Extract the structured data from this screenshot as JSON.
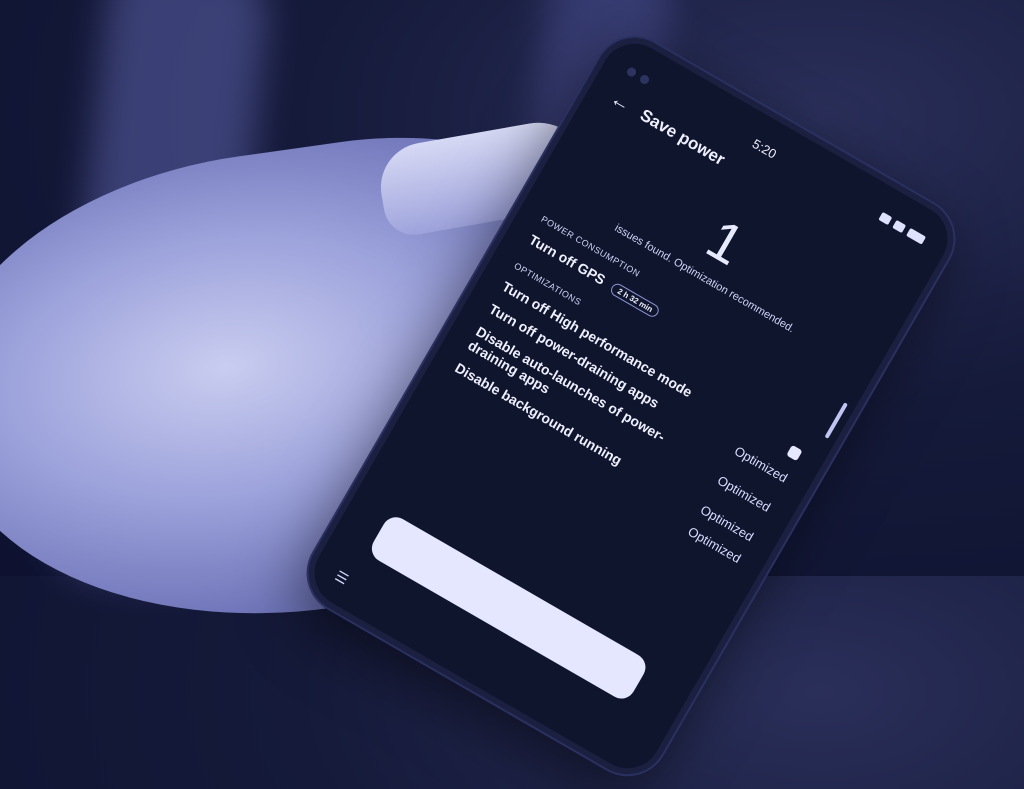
{
  "status": {
    "time": "5:20"
  },
  "header": {
    "back_icon": "arrow-left-icon",
    "title": "Save power"
  },
  "summary": {
    "count": "1",
    "message": "issues found. Optimization recommended."
  },
  "power_consumption": {
    "section_label": "POWER CONSUMPTION",
    "item_label": "Turn off GPS",
    "item_chip": "2 h 32 min"
  },
  "optimizations": {
    "section_label": "OPTIMIZATIONS",
    "items": [
      {
        "label": "Turn off High performance mode",
        "value": ""
      },
      {
        "label": "Turn off power-draining apps",
        "value": "Optimized"
      },
      {
        "label": "Disable auto-launches of power-draining apps",
        "value": "Optimized"
      },
      {
        "label": "Disable background running",
        "value": "Optimized"
      }
    ],
    "last_value": "Optimized"
  },
  "colors": {
    "tint": "#6e74b8",
    "screen_bg": "#10152e"
  }
}
